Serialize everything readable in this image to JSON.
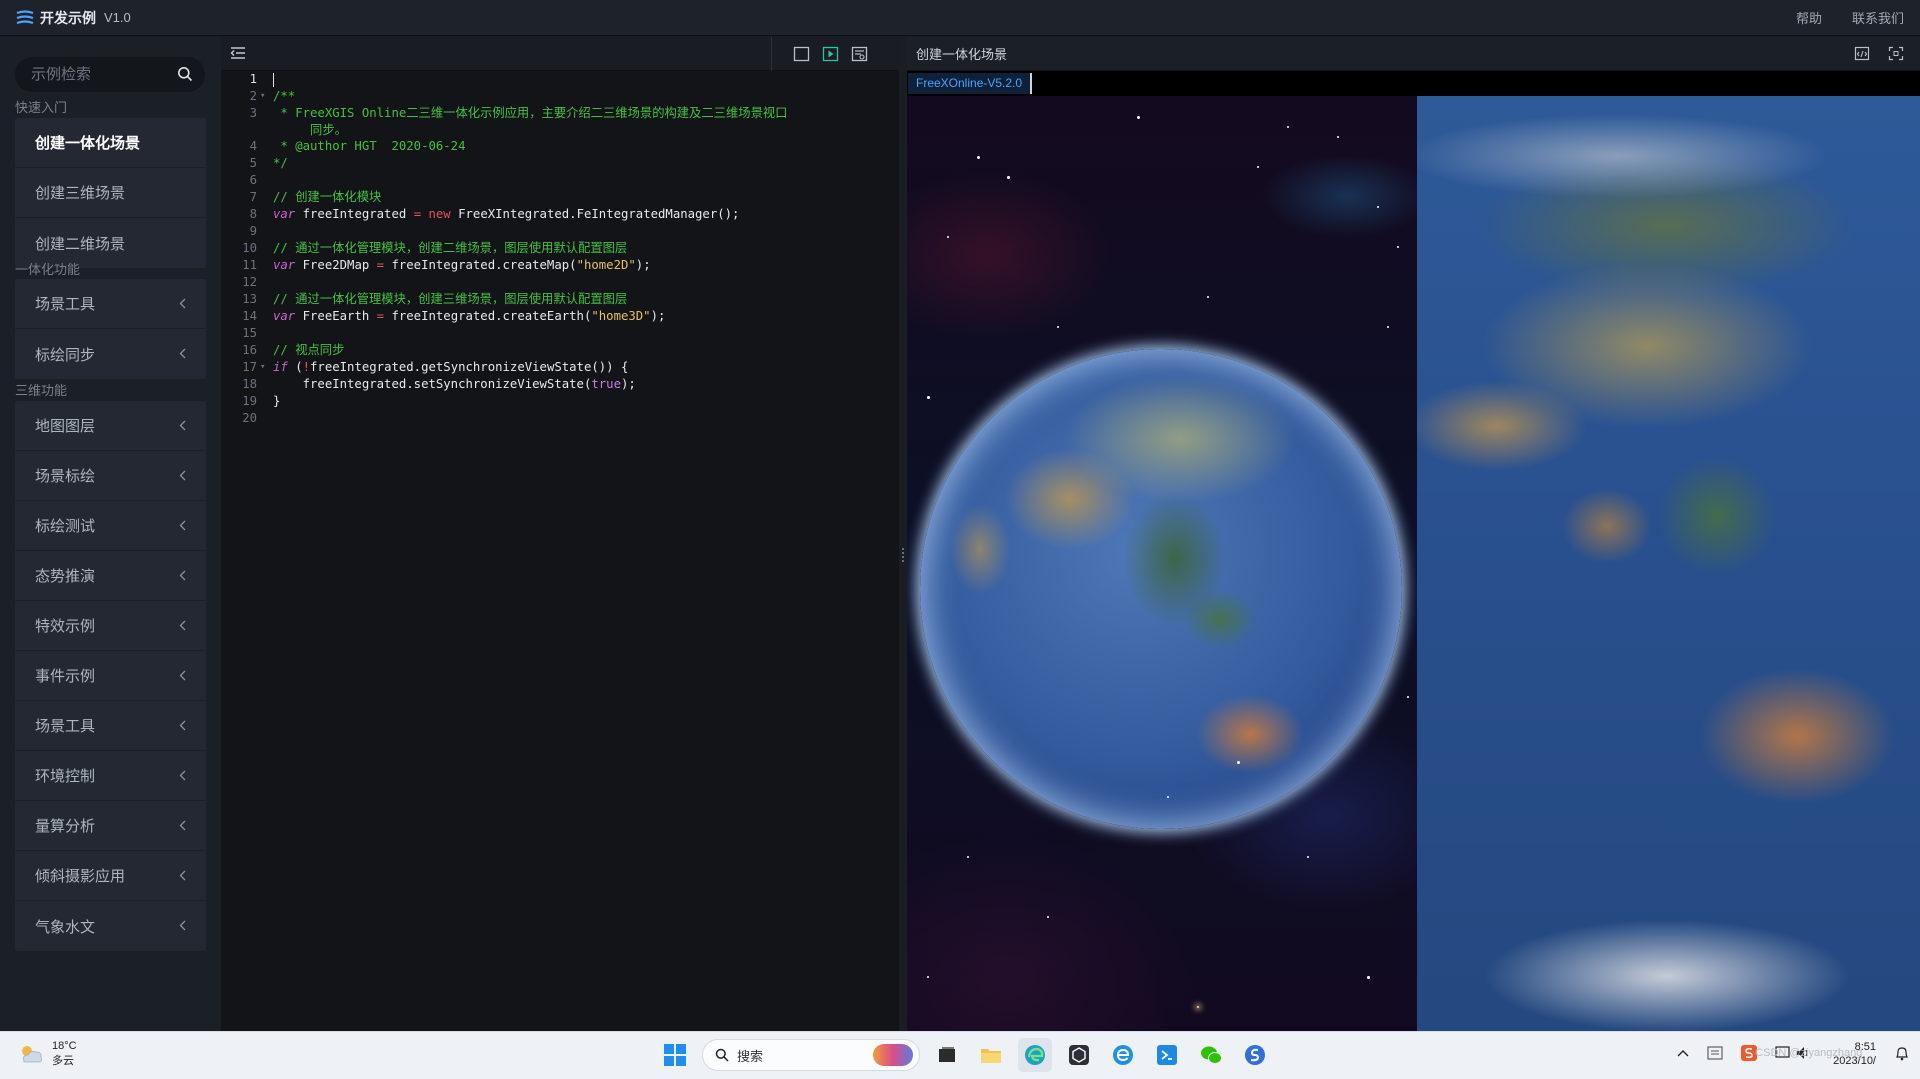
{
  "titlebar": {
    "app_title": "开发示例",
    "version": "V1.0",
    "help": "帮助",
    "contact": "联系我们"
  },
  "sidebar": {
    "search_placeholder": "示例检索",
    "sections": [
      {
        "title": "快速入门",
        "items": [
          "创建一体化场景",
          "创建三维场景",
          "创建二维场景"
        ]
      },
      {
        "title": "一体化功能",
        "items": [
          "场景工具",
          "标绘同步"
        ]
      },
      {
        "title": "三维功能",
        "items": [
          "地图图层",
          "场景标绘",
          "标绘测试",
          "态势推演",
          "特效示例",
          "事件示例",
          "场景工具",
          "环境控制",
          "量算分析",
          "倾斜摄影应用",
          "气象水文"
        ]
      }
    ],
    "active_item": "创建一体化场景"
  },
  "editor": {
    "lines": [
      {
        "n": "1",
        "code": ""
      },
      {
        "n": "2",
        "code": "/**"
      },
      {
        "n": "3",
        "code": " * FreeXGIS Online二三维一体化示例应用，主要介绍二三维场景的构建及二三维场景视口"
      },
      {
        "n": "",
        "code": "     同步。"
      },
      {
        "n": "4",
        "code": " * @author HGT  2020-06-24"
      },
      {
        "n": "5",
        "code": "*/"
      },
      {
        "n": "6",
        "code": ""
      },
      {
        "n": "7",
        "code": "// 创建一体化模块"
      },
      {
        "n": "8",
        "code": "var freeIntegrated = new FreeXIntegrated.FeIntegratedManager();"
      },
      {
        "n": "9",
        "code": ""
      },
      {
        "n": "10",
        "code": "// 通过一体化管理模块，创建二维场景，图层使用默认配置图层"
      },
      {
        "n": "11",
        "code": "var Free2DMap = freeIntegrated.createMap(\"home2D\");"
      },
      {
        "n": "12",
        "code": ""
      },
      {
        "n": "13",
        "code": "// 通过一体化管理模块，创建三维场景，图层使用默认配置图层"
      },
      {
        "n": "14",
        "code": "var FreeEarth = freeIntegrated.createEarth(\"home3D\");"
      },
      {
        "n": "15",
        "code": ""
      },
      {
        "n": "16",
        "code": "// 视点同步"
      },
      {
        "n": "17",
        "code": "if (!freeIntegrated.getSynchronizeViewState()) {"
      },
      {
        "n": "18",
        "code": "    freeIntegrated.setSynchronizeViewState(true);"
      },
      {
        "n": "19",
        "code": "}"
      },
      {
        "n": "20",
        "code": ""
      }
    ]
  },
  "preview": {
    "title": "创建一体化场景",
    "tab": "FreeXOnline-V5.2.0"
  },
  "taskbar": {
    "temperature": "18°C",
    "weather": "多云",
    "search_label": "搜索",
    "time": "8:51",
    "date": "2023/10/",
    "watermark": "CSDN @ziyangzhang"
  },
  "colors": {
    "comment": "#45c142",
    "keyword": "#d060d2",
    "string": "#e8c25a",
    "tab_accent": "#4aa3ff"
  }
}
